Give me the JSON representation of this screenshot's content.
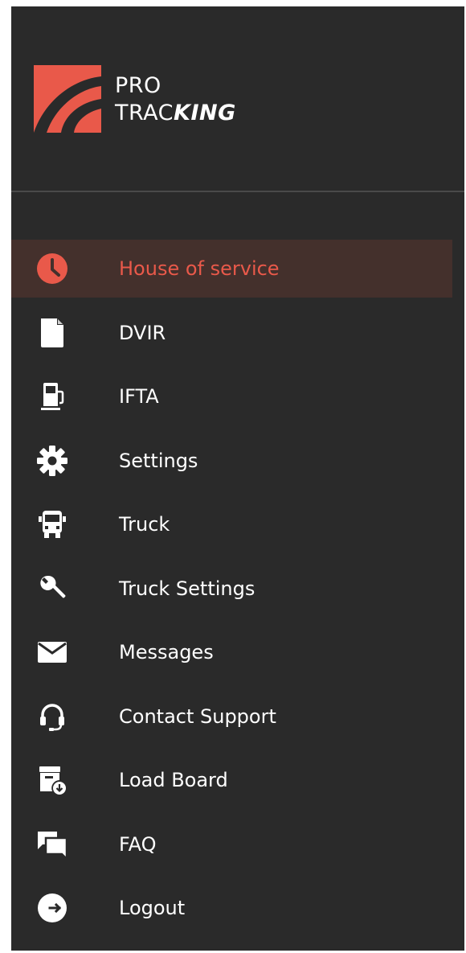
{
  "app": {
    "logo_line1": "PRO",
    "logo_line2_regular": "TRAC",
    "logo_line2_bold": "KING"
  },
  "colors": {
    "drawer_bg": "#2a2a2a",
    "accent": "#e9594a",
    "active_bg": "#44302c",
    "text": "#ffffff"
  },
  "menu": {
    "items": [
      {
        "label": "House of service",
        "icon": "clock-icon",
        "active": true
      },
      {
        "label": "DVIR",
        "icon": "document-icon",
        "active": false
      },
      {
        "label": "IFTA",
        "icon": "fuel-pump-icon",
        "active": false
      },
      {
        "label": "Settings",
        "icon": "gear-icon",
        "active": false
      },
      {
        "label": "Truck",
        "icon": "truck-icon",
        "active": false
      },
      {
        "label": "Truck Settings",
        "icon": "wrench-icon",
        "active": false
      },
      {
        "label": "Messages",
        "icon": "envelope-icon",
        "active": false
      },
      {
        "label": "Contact Support",
        "icon": "headset-icon",
        "active": false
      },
      {
        "label": "Load Board",
        "icon": "load-board-icon",
        "active": false
      },
      {
        "label": "FAQ",
        "icon": "chat-bubbles-icon",
        "active": false
      },
      {
        "label": "Logout",
        "icon": "logout-icon",
        "active": false
      }
    ]
  }
}
